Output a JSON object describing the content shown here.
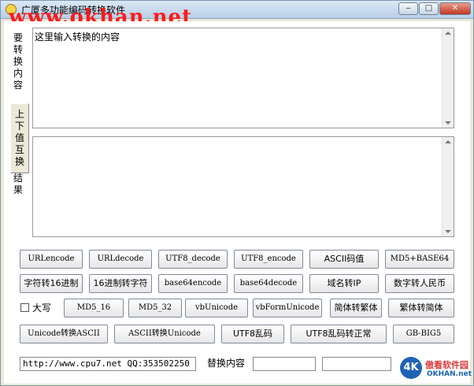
{
  "window": {
    "title": "广厦多功能编码转换软件",
    "watermark": "www.okhan.net",
    "minimize_label": "‒",
    "maximize_label": "□",
    "close_label": "✕"
  },
  "tabs": {
    "input_tab": "要转换内容",
    "swap_tab": "上下值互换",
    "result_tab": "结果"
  },
  "input_text": "这里输入转换的内容",
  "result_text": "",
  "buttons": {
    "row1": [
      "URLencode",
      "URLdecode",
      "UTF8_decode",
      "UTF8_encode",
      "ASCII码值",
      "MD5+BASE64"
    ],
    "row2": [
      "字符转16进制",
      "16进制转字符",
      "base64encode",
      "base64decode",
      "域名转IP",
      "数字转人民币"
    ],
    "row3": [
      "MD5_16",
      "MD5_32",
      "vbUnicode",
      "vbFormUnicode",
      "简体转繁体",
      "繁体转简体"
    ],
    "row4": [
      "Unicode转换ASCII",
      "ASCII转换Unicode",
      "UTF8乱码",
      "UTF8乱码转正常",
      "GB-BIG5"
    ]
  },
  "uppercase_label": "大写",
  "status_field": "http://www.cpu7.net QQ:353502250",
  "replace_label": "替换内容",
  "replace_from": "",
  "replace_to": "",
  "logo": {
    "mark": "4K",
    "name_cn": "傲看软件园",
    "name_en": "OKHAN.net"
  },
  "colors": {
    "watermark": "#ff1a1a",
    "logo_blue": "#1f62b5",
    "logo_red": "#d93a3a"
  }
}
